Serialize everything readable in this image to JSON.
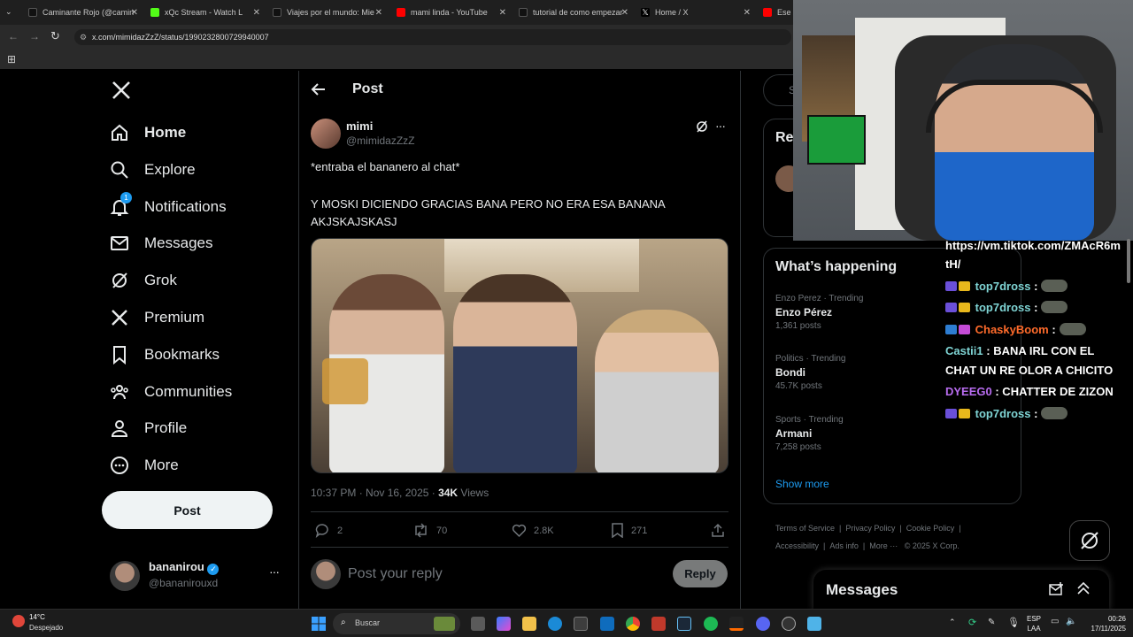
{
  "browser": {
    "tabs": [
      {
        "title": "Caminante Rojo (@camin"
      },
      {
        "title": "xQc Stream - Watch L"
      },
      {
        "title": "Viajes por el mundo: Mie"
      },
      {
        "title": "mami linda - YouTube"
      },
      {
        "title": "tutorial de como empezar"
      },
      {
        "title": "Home / X"
      },
      {
        "title": "Ese c"
      }
    ],
    "url": "x.com/mimidazZzZ/status/1990232800729940007"
  },
  "nav": {
    "items": [
      {
        "label": "Home",
        "icon": "home-icon"
      },
      {
        "label": "Explore",
        "icon": "search-icon"
      },
      {
        "label": "Notifications",
        "icon": "bell-icon",
        "badge": "1"
      },
      {
        "label": "Messages",
        "icon": "envelope-icon"
      },
      {
        "label": "Grok",
        "icon": "grok-icon"
      },
      {
        "label": "Premium",
        "icon": "x-logo-icon"
      },
      {
        "label": "Bookmarks",
        "icon": "bookmark-icon"
      },
      {
        "label": "Communities",
        "icon": "people-icon"
      },
      {
        "label": "Profile",
        "icon": "person-icon"
      },
      {
        "label": "More",
        "icon": "more-circle-icon"
      }
    ],
    "post_label": "Post",
    "account": {
      "name": "bananirou",
      "handle": "@bananirouxd"
    }
  },
  "post": {
    "header_title": "Post",
    "author_name": "mimi",
    "author_handle": "@mimidazZzZ",
    "text_line1": "*entraba el bananero al chat*",
    "text_line2": "Y MOSKI DICIENDO GRACIAS BANA PERO NO ERA ESA BANANA AKJSKAJSKASJ",
    "timestamp": "10:37 PM · Nov 16, 2025 · ",
    "views_count": "34K",
    "views_label": " Views",
    "replies": "2",
    "reposts": "70",
    "likes": "2.8K",
    "bookmarks": "271",
    "reply_placeholder": "Post your reply",
    "reply_button": "Reply"
  },
  "right": {
    "search_placeholder": "S",
    "relevant_title": "Re",
    "happening_title": "What’s happening",
    "trends": [
      {
        "meta": "Enzo Perez · Trending",
        "name": "Enzo Pérez",
        "count": "1,361 posts"
      },
      {
        "meta": "Politics · Trending",
        "name": "Bondi",
        "count": "45.7K posts"
      },
      {
        "meta": "Sports · Trending",
        "name": "Armani",
        "count": "7,258 posts"
      }
    ],
    "show_more": "Show more",
    "footer_links": [
      "Terms of Service",
      "Privacy Policy",
      "Cookie Policy",
      "Accessibility",
      "Ads info",
      "More ···",
      "© 2025 X Corp."
    ],
    "messages_title": "Messages"
  },
  "chat": {
    "lines": [
      {
        "user": "",
        "text": "https://vm.tiktok.com/ZMAcR6m",
        "user_color": "#ffffff"
      },
      {
        "user": "",
        "text": "tH/",
        "user_color": "#ffffff"
      },
      {
        "user": "top7dross",
        "text": " :",
        "user_color": "#7fd4d4",
        "emote": true
      },
      {
        "user": "top7dross",
        "text": " :",
        "user_color": "#7fd4d4",
        "emote": true
      },
      {
        "user": "ChaskyBoom",
        "text": " :",
        "user_color": "#ff6b2b",
        "emote": true
      },
      {
        "user": "Castii1",
        "text": " : BANA IRL CON EL",
        "user_color": "#7fd4d4"
      },
      {
        "user": "",
        "text": "CHAT UN RE OLOR A CHICITO",
        "user_color": "#ffffff"
      },
      {
        "user": "DYEEG0",
        "text": " : CHATTER DE ZIZON",
        "user_color": "#b86cf0"
      },
      {
        "user": "top7dross",
        "text": " :",
        "user_color": "#7fd4d4",
        "emote": true
      }
    ]
  },
  "taskbar": {
    "weather_temp": "14°C",
    "weather_desc": "Despejado",
    "search_label": "Buscar",
    "lang_line1": "ESP",
    "lang_line2": "LAA",
    "time": "00:26",
    "date": "17/11/2025"
  },
  "colors": {
    "accent": "#1d9bf0",
    "background": "#000000",
    "border": "#2f3336",
    "muted": "#71767b"
  }
}
